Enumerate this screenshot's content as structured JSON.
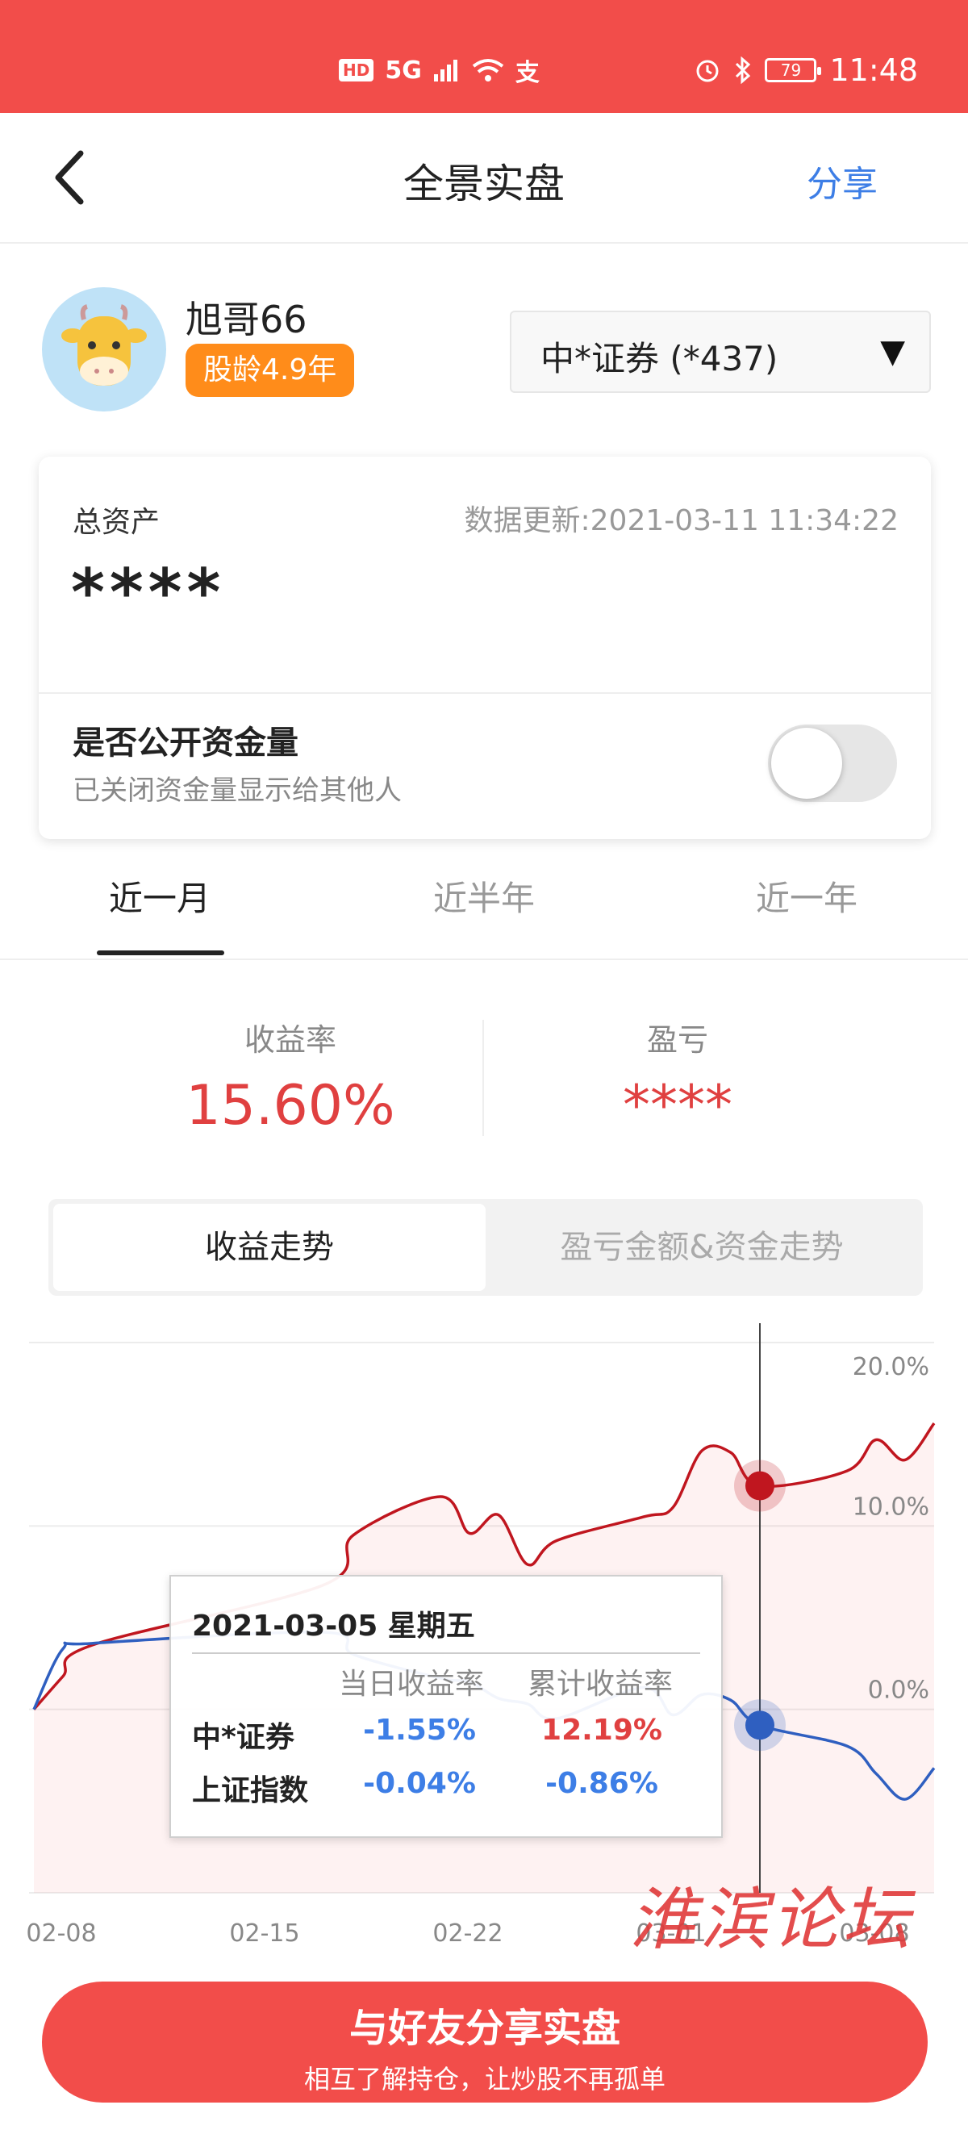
{
  "status_bar": {
    "hd": "HD",
    "network": "5G",
    "alipay_icon": "支",
    "battery": "79",
    "time": "11:48"
  },
  "nav": {
    "title": "全景实盘",
    "share": "分享"
  },
  "profile": {
    "username": "旭哥66",
    "stock_age": "股龄4.9年",
    "broker": "中*证券 (*437)",
    "dropdown_arrow": "▼"
  },
  "asset": {
    "label": "总资产",
    "update": "数据更新:2021-03-11 11:34:22",
    "value": "****",
    "public_title": "是否公开资金量",
    "public_sub": "已关闭资金量显示给其他人",
    "public_toggle_on": false
  },
  "periods": [
    {
      "label": "近一月",
      "active": true
    },
    {
      "label": "近半年",
      "active": false
    },
    {
      "label": "近一年",
      "active": false
    }
  ],
  "stats": {
    "return_label": "收益率",
    "return_value": "15.60%",
    "pnl_label": "盈亏",
    "pnl_value": "****"
  },
  "chart_tabs": {
    "active": "收益走势",
    "inactive": "盈亏金额&资金走势"
  },
  "chart_data": {
    "type": "line",
    "yticks": [
      "20.0%",
      "10.0%",
      "0.0%"
    ],
    "ylim": [
      -10,
      20
    ],
    "xticks": [
      "02-08",
      "02-15",
      "02-22",
      "03-01",
      "03-08"
    ],
    "series": [
      {
        "name": "中*证券",
        "color": "#c0161f",
        "dates": [
          "02-08",
          "02-09",
          "02-10",
          "02-18",
          "02-19",
          "02-22",
          "02-23",
          "02-24",
          "02-25",
          "02-26",
          "03-01",
          "03-02",
          "03-03",
          "03-04",
          "03-05",
          "03-08",
          "03-09",
          "03-10",
          "03-11"
        ],
        "values": [
          0.0,
          1.8,
          3.5,
          6.8,
          9.5,
          11.6,
          9.6,
          10.6,
          7.9,
          9.2,
          10.5,
          11.0,
          14.1,
          14.0,
          12.19,
          13.0,
          14.7,
          13.6,
          15.6
        ]
      },
      {
        "name": "上证指数",
        "color": "#2f5fc0",
        "dates": [
          "02-08",
          "02-09",
          "02-10",
          "02-18",
          "02-19",
          "02-22",
          "02-23",
          "02-24",
          "02-25",
          "02-26",
          "03-01",
          "03-02",
          "03-03",
          "03-04",
          "03-05",
          "03-08",
          "03-09",
          "03-10",
          "03-11"
        ],
        "values": [
          0.0,
          3.3,
          3.6,
          4.2,
          3.0,
          1.7,
          1.5,
          0.6,
          0.3,
          -0.5,
          1.2,
          -0.3,
          0.8,
          0.5,
          -0.86,
          -2.0,
          -3.5,
          -4.9,
          -3.2
        ]
      }
    ],
    "selected_index": 14
  },
  "tooltip": {
    "date": "2021-03-05 星期五",
    "col_daily": "当日收益率",
    "col_cumulative": "累计收益率",
    "rows": [
      {
        "name": "中*证券",
        "daily": "-1.55%",
        "cumulative": "12.19%"
      },
      {
        "name": "上证指数",
        "daily": "-0.04%",
        "cumulative": "-0.86%"
      }
    ]
  },
  "watermark": "淮滨论坛",
  "share_button": {
    "main": "与好友分享实盘",
    "sub": "相互了解持仓，让炒股不再孤单"
  }
}
